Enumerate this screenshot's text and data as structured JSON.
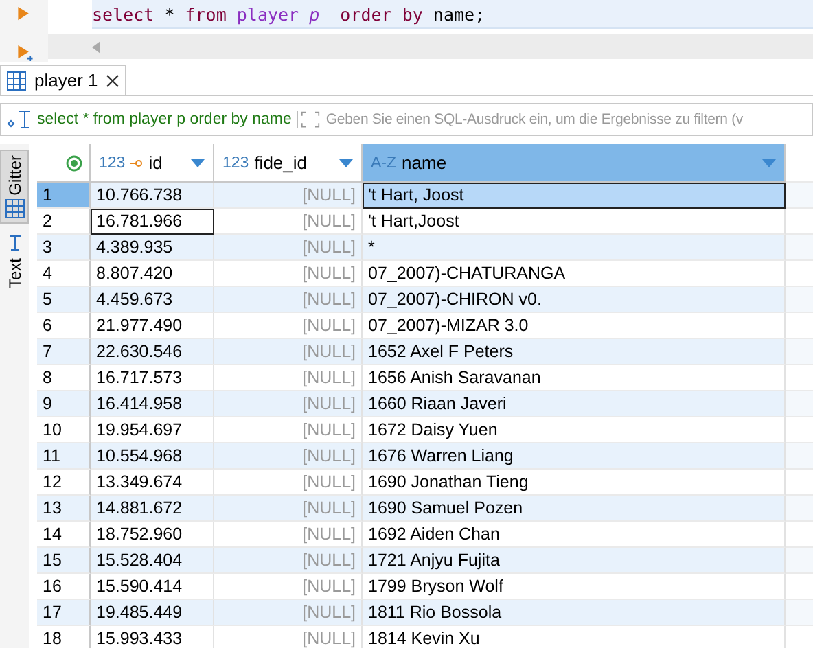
{
  "editor": {
    "tokens": [
      {
        "text": "select",
        "kind": "keyword"
      },
      {
        "text": "*",
        "kind": "plain"
      },
      {
        "text": "from",
        "kind": "keyword"
      },
      {
        "text": "player",
        "kind": "table"
      },
      {
        "text": "p",
        "kind": "alias"
      },
      {
        "text": " order",
        "kind": "keyword"
      },
      {
        "text": "by",
        "kind": "keyword"
      },
      {
        "text": "name;",
        "kind": "plain"
      }
    ]
  },
  "result_tab": {
    "label": "player 1",
    "selected": true
  },
  "filter": {
    "query": "select * from player p order by name",
    "placeholder": "Geben Sie einen SQL-Ausdruck ein, um die Ergebnisse zu filtern (v"
  },
  "side_tabs": [
    {
      "label": "Gitter",
      "selected": true,
      "kind": "grid"
    },
    {
      "label": "Text",
      "selected": false,
      "kind": "text"
    }
  ],
  "columns": [
    {
      "type": "123",
      "label": "id",
      "key": true,
      "sorted": false
    },
    {
      "type": "123",
      "label": "fide_id",
      "key": false,
      "sorted": false
    },
    {
      "type": "A-Z",
      "label": "name",
      "key": false,
      "sorted": true
    }
  ],
  "rows": [
    {
      "num": "1",
      "id": "10.766.738",
      "fide_id": "[NULL]",
      "name": "'t Hart, Joost",
      "selected": true,
      "focused": false
    },
    {
      "num": "2",
      "id": "16.781.966",
      "fide_id": "[NULL]",
      "name": "'t Hart,Joost",
      "selected": false,
      "focused": true
    },
    {
      "num": "3",
      "id": "4.389.935",
      "fide_id": "[NULL]",
      "name": "*",
      "selected": false,
      "focused": false
    },
    {
      "num": "4",
      "id": "8.807.420",
      "fide_id": "[NULL]",
      "name": "07_2007)-CHATURANGA",
      "selected": false,
      "focused": false
    },
    {
      "num": "5",
      "id": "4.459.673",
      "fide_id": "[NULL]",
      "name": "07_2007)-CHIRON v0.",
      "selected": false,
      "focused": false
    },
    {
      "num": "6",
      "id": "21.977.490",
      "fide_id": "[NULL]",
      "name": "07_2007)-MIZAR 3.0",
      "selected": false,
      "focused": false
    },
    {
      "num": "7",
      "id": "22.630.546",
      "fide_id": "[NULL]",
      "name": "1652 Axel F Peters",
      "selected": false,
      "focused": false
    },
    {
      "num": "8",
      "id": "16.717.573",
      "fide_id": "[NULL]",
      "name": "1656 Anish Saravanan",
      "selected": false,
      "focused": false
    },
    {
      "num": "9",
      "id": "16.414.958",
      "fide_id": "[NULL]",
      "name": "1660 Riaan Javeri",
      "selected": false,
      "focused": false
    },
    {
      "num": "10",
      "id": "19.954.697",
      "fide_id": "[NULL]",
      "name": "1672 Daisy Yuen",
      "selected": false,
      "focused": false
    },
    {
      "num": "11",
      "id": "10.554.968",
      "fide_id": "[NULL]",
      "name": "1676 Warren Liang",
      "selected": false,
      "focused": false
    },
    {
      "num": "12",
      "id": "13.349.674",
      "fide_id": "[NULL]",
      "name": "1690 Jonathan Tieng",
      "selected": false,
      "focused": false
    },
    {
      "num": "13",
      "id": "14.881.672",
      "fide_id": "[NULL]",
      "name": "1690 Samuel Pozen",
      "selected": false,
      "focused": false
    },
    {
      "num": "14",
      "id": "18.752.960",
      "fide_id": "[NULL]",
      "name": "1692 Aiden Chan",
      "selected": false,
      "focused": false
    },
    {
      "num": "15",
      "id": "15.528.404",
      "fide_id": "[NULL]",
      "name": "1721 Anjyu Fujita",
      "selected": false,
      "focused": false
    },
    {
      "num": "16",
      "id": "15.590.414",
      "fide_id": "[NULL]",
      "name": "1799 Bryson Wolf",
      "selected": false,
      "focused": false
    },
    {
      "num": "17",
      "id": "19.485.449",
      "fide_id": "[NULL]",
      "name": "1811 Rio Bossola",
      "selected": false,
      "focused": false
    },
    {
      "num": "18",
      "id": "15.993.433",
      "fide_id": "[NULL]",
      "name": "1814 Kevin Xu",
      "selected": false,
      "focused": false
    }
  ]
}
